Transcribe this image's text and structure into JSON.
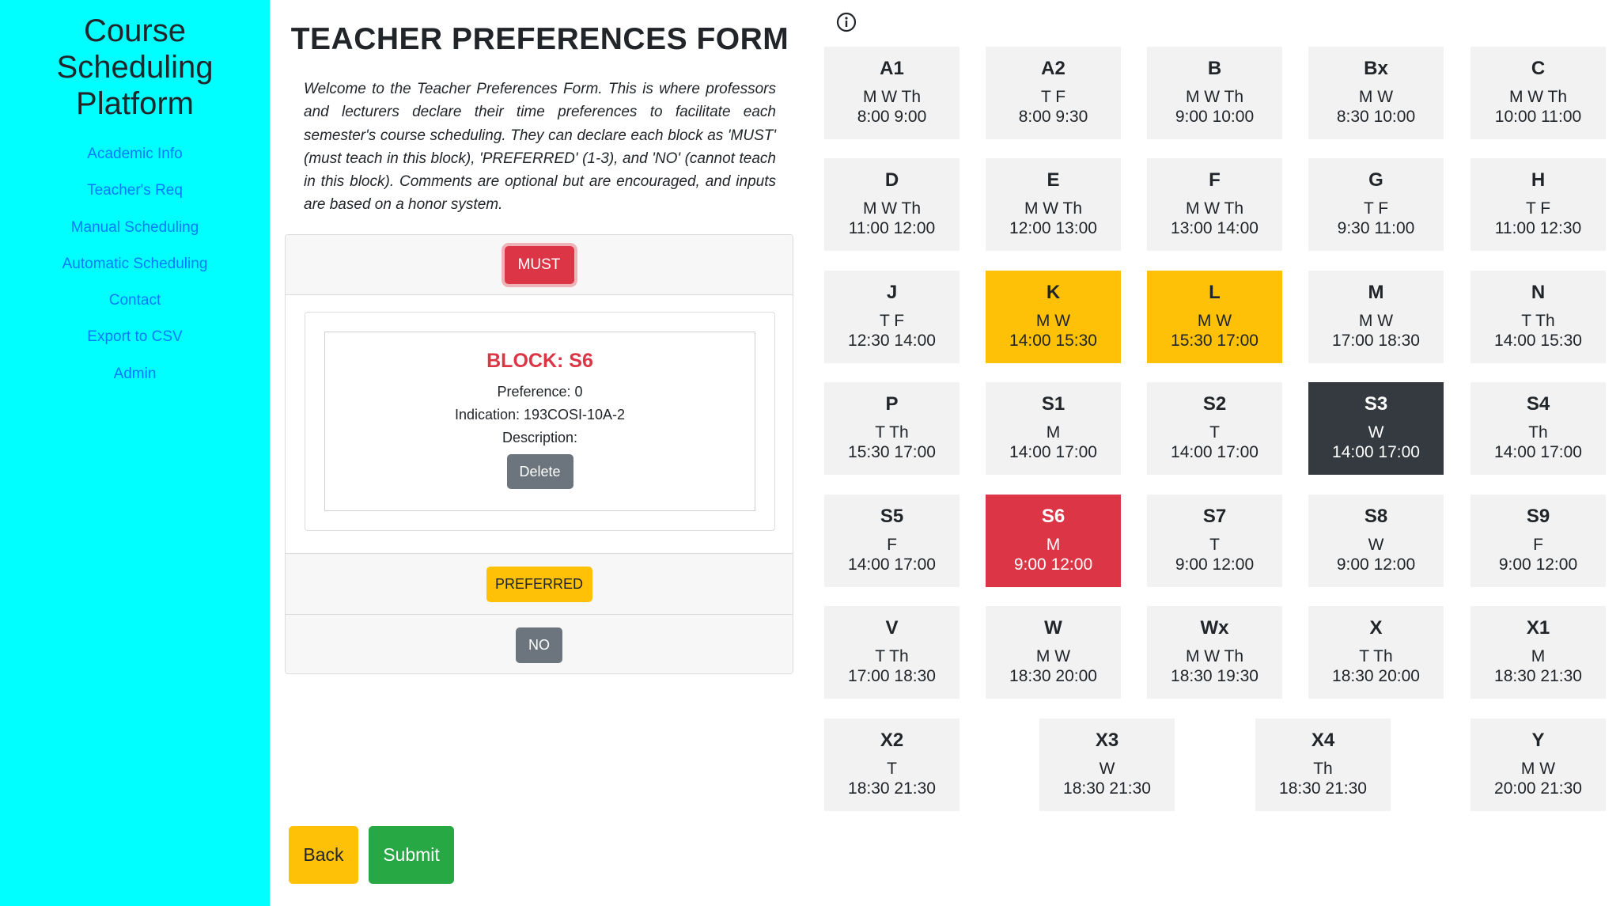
{
  "sidebar": {
    "brand": "Course\nScheduling\nPlatform",
    "items": [
      {
        "label": "Academic Info"
      },
      {
        "label": "Teacher's Req"
      },
      {
        "label": "Manual Scheduling"
      },
      {
        "label": "Automatic Scheduling"
      },
      {
        "label": "Contact"
      },
      {
        "label": "Export to CSV"
      },
      {
        "label": "Admin"
      }
    ]
  },
  "form": {
    "title": "TEACHER PREFERENCES FORM",
    "intro": "Welcome to the Teacher Preferences Form. This is where professors and lecturers declare their time preferences to facilitate each semester's course scheduling. They can declare each block as 'MUST' (must teach in this block), 'PREFERRED' (1-3), and 'NO' (cannot teach in this block). Comments are optional but are encouraged, and inputs are based on a honor system.",
    "must_label": "MUST",
    "preferred_label": "PREFERRED",
    "no_label": "NO",
    "selected_block": {
      "title": "BLOCK: S6",
      "preference": "Preference: 0",
      "indication": "Indication: 193COSI-10A-2",
      "description": "Description:",
      "delete_label": "Delete"
    },
    "back_label": "Back",
    "submit_label": "Submit"
  },
  "colors": {
    "sidebar_bg": "#00ffff",
    "must": "#dc3545",
    "preferred": "#ffc107",
    "no": "#6c757d",
    "selected_dark": "#343a40",
    "submit": "#28a745",
    "block_bg": "#f2f2f2"
  },
  "blocks": [
    {
      "code": "A1",
      "days": "M W Th",
      "time": "8:00 9:00",
      "state": "none"
    },
    {
      "code": "A2",
      "days": "T F",
      "time": "8:00 9:30",
      "state": "none"
    },
    {
      "code": "B",
      "days": "M W Th",
      "time": "9:00 10:00",
      "state": "none"
    },
    {
      "code": "Bx",
      "days": "M W",
      "time": "8:30 10:00",
      "state": "none"
    },
    {
      "code": "C",
      "days": "M W Th",
      "time": "10:00 11:00",
      "state": "none"
    },
    {
      "code": "D",
      "days": "M W Th",
      "time": "11:00 12:00",
      "state": "none"
    },
    {
      "code": "E",
      "days": "M W Th",
      "time": "12:00 13:00",
      "state": "none"
    },
    {
      "code": "F",
      "days": "M W Th",
      "time": "13:00 14:00",
      "state": "none"
    },
    {
      "code": "G",
      "days": "T F",
      "time": "9:30 11:00",
      "state": "none"
    },
    {
      "code": "H",
      "days": "T F",
      "time": "11:00 12:30",
      "state": "none"
    },
    {
      "code": "J",
      "days": "T F",
      "time": "12:30 14:00",
      "state": "none"
    },
    {
      "code": "K",
      "days": "M W",
      "time": "14:00 15:30",
      "state": "preferred"
    },
    {
      "code": "L",
      "days": "M W",
      "time": "15:30 17:00",
      "state": "preferred"
    },
    {
      "code": "M",
      "days": "M W",
      "time": "17:00 18:30",
      "state": "none"
    },
    {
      "code": "N",
      "days": "T Th",
      "time": "14:00 15:30",
      "state": "none"
    },
    {
      "code": "P",
      "days": "T Th",
      "time": "15:30 17:00",
      "state": "none"
    },
    {
      "code": "S1",
      "days": "M",
      "time": "14:00 17:00",
      "state": "none"
    },
    {
      "code": "S2",
      "days": "T",
      "time": "14:00 17:00",
      "state": "none"
    },
    {
      "code": "S3",
      "days": "W",
      "time": "14:00 17:00",
      "state": "no"
    },
    {
      "code": "S4",
      "days": "Th",
      "time": "14:00 17:00",
      "state": "none"
    },
    {
      "code": "S5",
      "days": "F",
      "time": "14:00 17:00",
      "state": "none"
    },
    {
      "code": "S6",
      "days": "M",
      "time": "9:00 12:00",
      "state": "must"
    },
    {
      "code": "S7",
      "days": "T",
      "time": "9:00 12:00",
      "state": "none"
    },
    {
      "code": "S8",
      "days": "W",
      "time": "9:00 12:00",
      "state": "none"
    },
    {
      "code": "S9",
      "days": "F",
      "time": "9:00 12:00",
      "state": "none"
    },
    {
      "code": "V",
      "days": "T Th",
      "time": "17:00 18:30",
      "state": "none"
    },
    {
      "code": "W",
      "days": "M W",
      "time": "18:30 20:00",
      "state": "none"
    },
    {
      "code": "Wx",
      "days": "M W Th",
      "time": "18:30 19:30",
      "state": "none"
    },
    {
      "code": "X",
      "days": "T Th",
      "time": "18:30 20:00",
      "state": "none"
    },
    {
      "code": "X1",
      "days": "M",
      "time": "18:30 21:30",
      "state": "none"
    },
    {
      "code": "X2",
      "days": "T",
      "time": "18:30 21:30",
      "state": "none"
    },
    {
      "code": "X3",
      "days": "W",
      "time": "18:30 21:30",
      "state": "none"
    },
    {
      "code": "X4",
      "days": "Th",
      "time": "18:30 21:30",
      "state": "none"
    },
    {
      "code": "Y",
      "days": "M W",
      "time": "20:00 21:30",
      "state": "none"
    }
  ]
}
